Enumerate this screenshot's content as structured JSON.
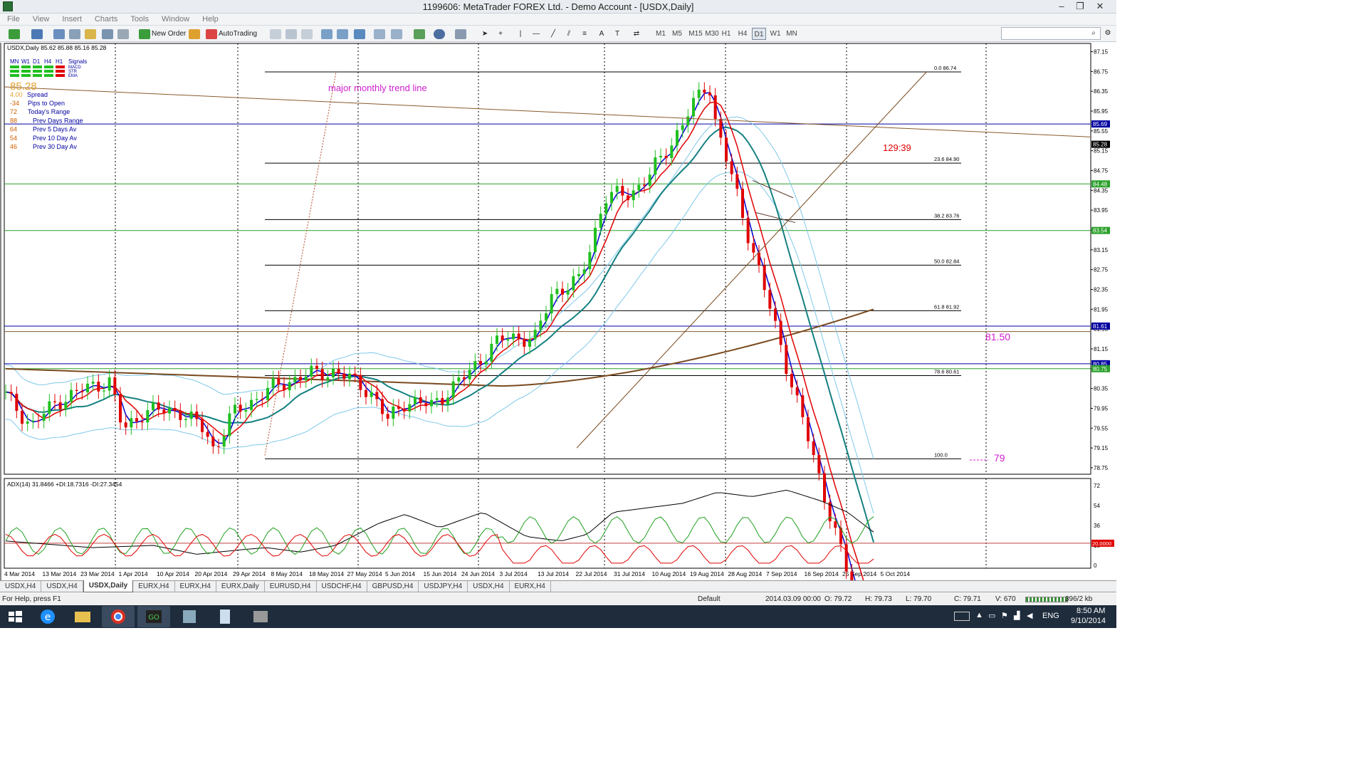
{
  "window": {
    "title": "1199606: MetaTrader FOREX Ltd. - Demo Account - [USDX,Daily]"
  },
  "menu": [
    "File",
    "View",
    "Insert",
    "Charts",
    "Tools",
    "Window",
    "Help"
  ],
  "toolbar": {
    "new_order": "New Order",
    "autotrading": "AutoTrading",
    "timeframes": [
      "M1",
      "M5",
      "M15",
      "M30",
      "H1",
      "H4",
      "D1",
      "W1",
      "MN"
    ],
    "active_tf": "D1"
  },
  "chart": {
    "symbol_header": "USDX,Daily  85.62 85.88 85.16 85.28",
    "signals": {
      "timeframes": [
        "MN",
        "W1",
        "D1",
        "H4",
        "H1"
      ],
      "title": "Signals",
      "rows": [
        "MACD",
        "STR",
        "EMA"
      ]
    },
    "panel": {
      "price": "85.28",
      "spread": "4.00",
      "spread_label": "Spread",
      "rows": [
        {
          "value": "-34",
          "label": "Pips to Open"
        },
        {
          "value": "72",
          "label": "Today's Range"
        },
        {
          "value": "88",
          "label": "Prev Days Range"
        },
        {
          "value": "64",
          "label": "Prev 5 Days Av"
        },
        {
          "value": "54",
          "label": "Prev 10 Day Av"
        },
        {
          "value": "46",
          "label": "Prev 30 Day Av"
        }
      ]
    },
    "annotations": {
      "trend": "major monthly trend line",
      "timer": "129:39",
      "level_81": "81.50",
      "level_79": "79"
    },
    "fib": [
      {
        "level": "0.0",
        "price": "86.74",
        "value": 86.74
      },
      {
        "level": "23.6",
        "price": "84.90",
        "value": 84.9
      },
      {
        "level": "38.2",
        "price": "83.76",
        "value": 83.76
      },
      {
        "level": "50.0",
        "price": "82.84",
        "value": 82.84
      },
      {
        "level": "61.8",
        "price": "81.92",
        "value": 81.92
      },
      {
        "level": "78.6",
        "price": "80.61",
        "value": 80.61
      },
      {
        "level": "100.0",
        "price": "",
        "value": 78.93
      }
    ],
    "price_axis": [
      "87.15",
      "86.75",
      "86.35",
      "85.95",
      "85.55",
      "85.15",
      "84.75",
      "84.35",
      "83.95",
      "83.55",
      "83.15",
      "82.75",
      "82.35",
      "81.95",
      "81.55",
      "81.15",
      "80.75",
      "80.35",
      "79.95",
      "79.55",
      "79.15",
      "78.75"
    ],
    "price_tags": [
      {
        "label": "85.69",
        "value": 85.69,
        "color": "#0000a0"
      },
      {
        "label": "85.28",
        "value": 85.28,
        "color": "#000000"
      },
      {
        "label": "84.48",
        "value": 84.48,
        "color": "#2aa02a"
      },
      {
        "label": "83.54",
        "value": 83.54,
        "color": "#2aa02a"
      },
      {
        "label": "81.61",
        "value": 81.61,
        "color": "#0000a0"
      },
      {
        "label": "80.85",
        "value": 80.85,
        "color": "#0000a0"
      },
      {
        "label": "80.75",
        "value": 80.75,
        "color": "#2aa02a"
      }
    ],
    "adx": {
      "label": "ADX(14) 31.8466 +DI:18.7316 -DI:27.3454",
      "axis": [
        "72",
        "54",
        "36",
        "18",
        "0"
      ],
      "level_tag": "20.0000"
    },
    "dates": [
      "4 Mar 2014",
      "13 Mar 2014",
      "23 Mar 2014",
      "1 Apr 2014",
      "10 Apr 2014",
      "20 Apr 2014",
      "29 Apr 2014",
      "8 May 2014",
      "18 May 2014",
      "27 May 2014",
      "5 Jun 2014",
      "15 Jun 2014",
      "24 Jun 2014",
      "3 Jul 2014",
      "13 Jul 2014",
      "22 Jul 2014",
      "31 Jul 2014",
      "10 Aug 2014",
      "19 Aug 2014",
      "28 Aug 2014",
      "7 Sep 2014",
      "16 Sep 2014",
      "25 Sep 2014",
      "5 Oct 2014"
    ]
  },
  "tabs": [
    "USDX,H4",
    "USDX,H4",
    "USDX,Daily",
    "EURX,H4",
    "EURX,H4",
    "EURX,Daily",
    "EURUSD,H4",
    "USDCHF,H4",
    "GBPUSD,H4",
    "USDJPY,H4",
    "USDX,H4",
    "EURX,H4"
  ],
  "active_tab": 2,
  "status": {
    "help": "For Help, press F1",
    "profile": "Default",
    "time": "2014.03.09 00:00",
    "o": "O: 79.72",
    "h": "H: 79.73",
    "l": "L: 79.70",
    "c": "C: 79.71",
    "v": "V: 670",
    "net": "396/2 kb"
  },
  "taskbar": {
    "lang": "ENG",
    "time": "8:50 AM",
    "date": "9/10/2014"
  }
}
